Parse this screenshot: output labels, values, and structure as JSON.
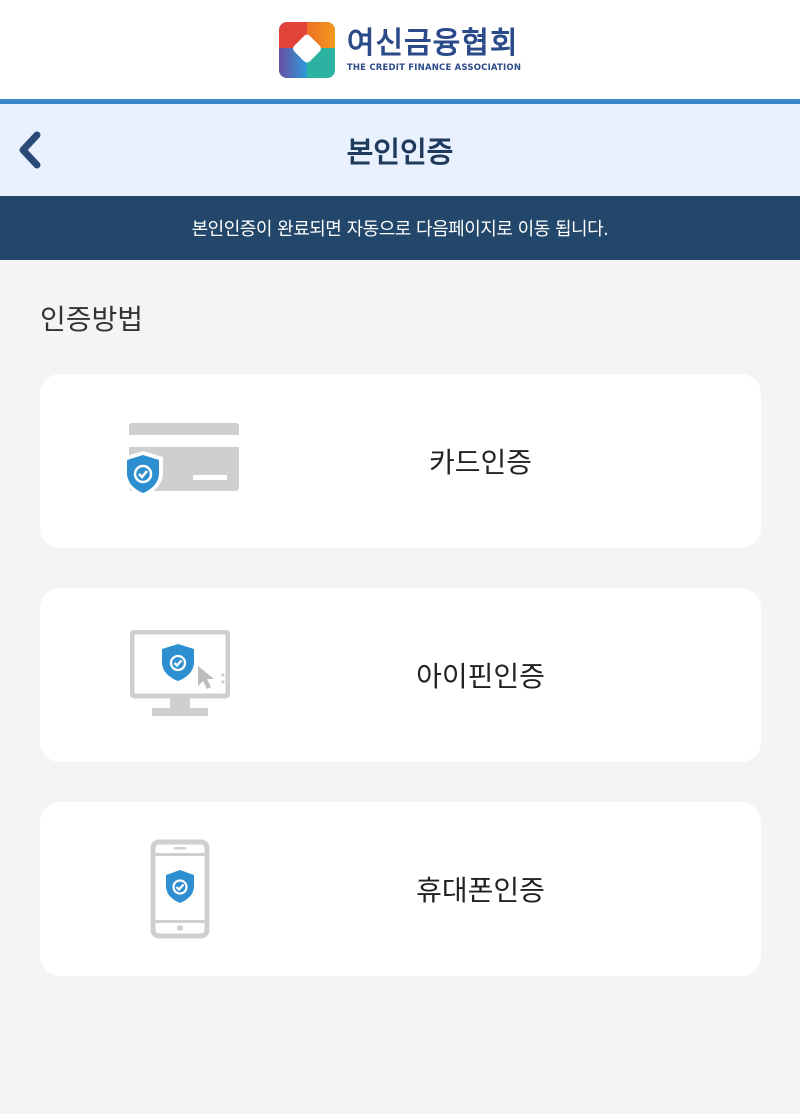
{
  "header": {
    "logo_ko": "여신금융협회",
    "logo_en": "THE CREDIT FINANCE ASSOCIATION"
  },
  "titlebar": {
    "title": "본인인증",
    "back_icon": "chevron-left-icon"
  },
  "notice": {
    "text": "본인인증이 완료되면 자동으로 다음페이지로 이동 됩니다."
  },
  "section": {
    "title": "인증방법"
  },
  "methods": [
    {
      "label": "카드인증",
      "icon": "card-shield-icon"
    },
    {
      "label": "아이핀인증",
      "icon": "monitor-shield-icon"
    },
    {
      "label": "휴대폰인증",
      "icon": "phone-shield-icon"
    }
  ],
  "colors": {
    "accent_blue": "#3a86c8",
    "notice_bg": "#22476a",
    "titlebar_bg": "#e8f1fd",
    "shield_blue": "#2e8fd0",
    "icon_gray": "#cfcfcf"
  }
}
